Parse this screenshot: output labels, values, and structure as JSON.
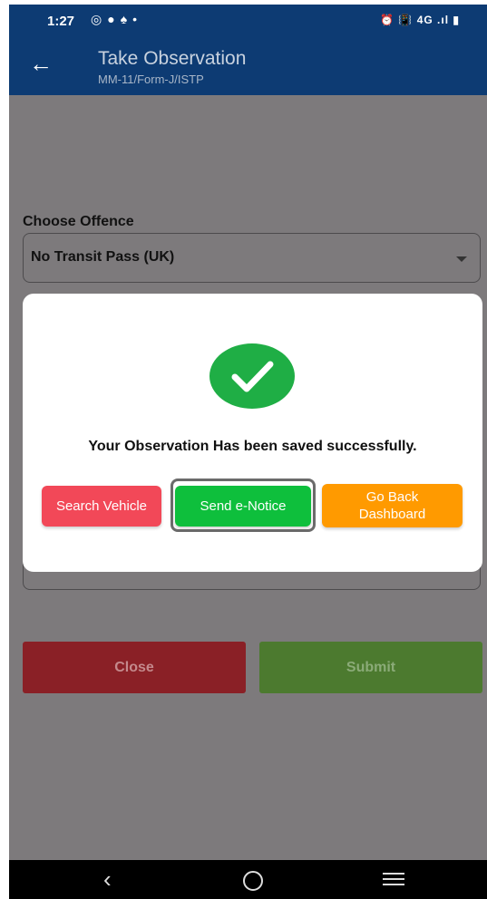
{
  "status_bar": {
    "time": "1:27",
    "left_icons": [
      "whatsapp-icon",
      "facebook-icon",
      "snapchat-icon",
      "dot-icon"
    ],
    "right_text": "⏰ 📳 4G .ıl ▮"
  },
  "header": {
    "title": "Take Observation",
    "subtitle": "MM-11/Form-J/ISTP"
  },
  "form": {
    "offence_label": "Choose Offence",
    "offence_value": "No Transit Pass (UK)"
  },
  "footer_buttons": {
    "close": "Close",
    "submit": "Submit"
  },
  "modal": {
    "message": "Your Observation Has been saved successfully.",
    "search_vehicle": "Search Vehicle",
    "send_enotice": "Send e-Notice",
    "go_back_line1": "Go Back",
    "go_back_line2": "Dashboard"
  },
  "colors": {
    "header_bg": "#0d3b73",
    "overlay": "#7d7a7c",
    "success_green": "#1fae45",
    "search_red": "#f24858",
    "send_green": "#0ebf3c",
    "back_orange": "#ff9a00",
    "close_red": "#8a2026",
    "submit_green": "#4c7a2f"
  }
}
